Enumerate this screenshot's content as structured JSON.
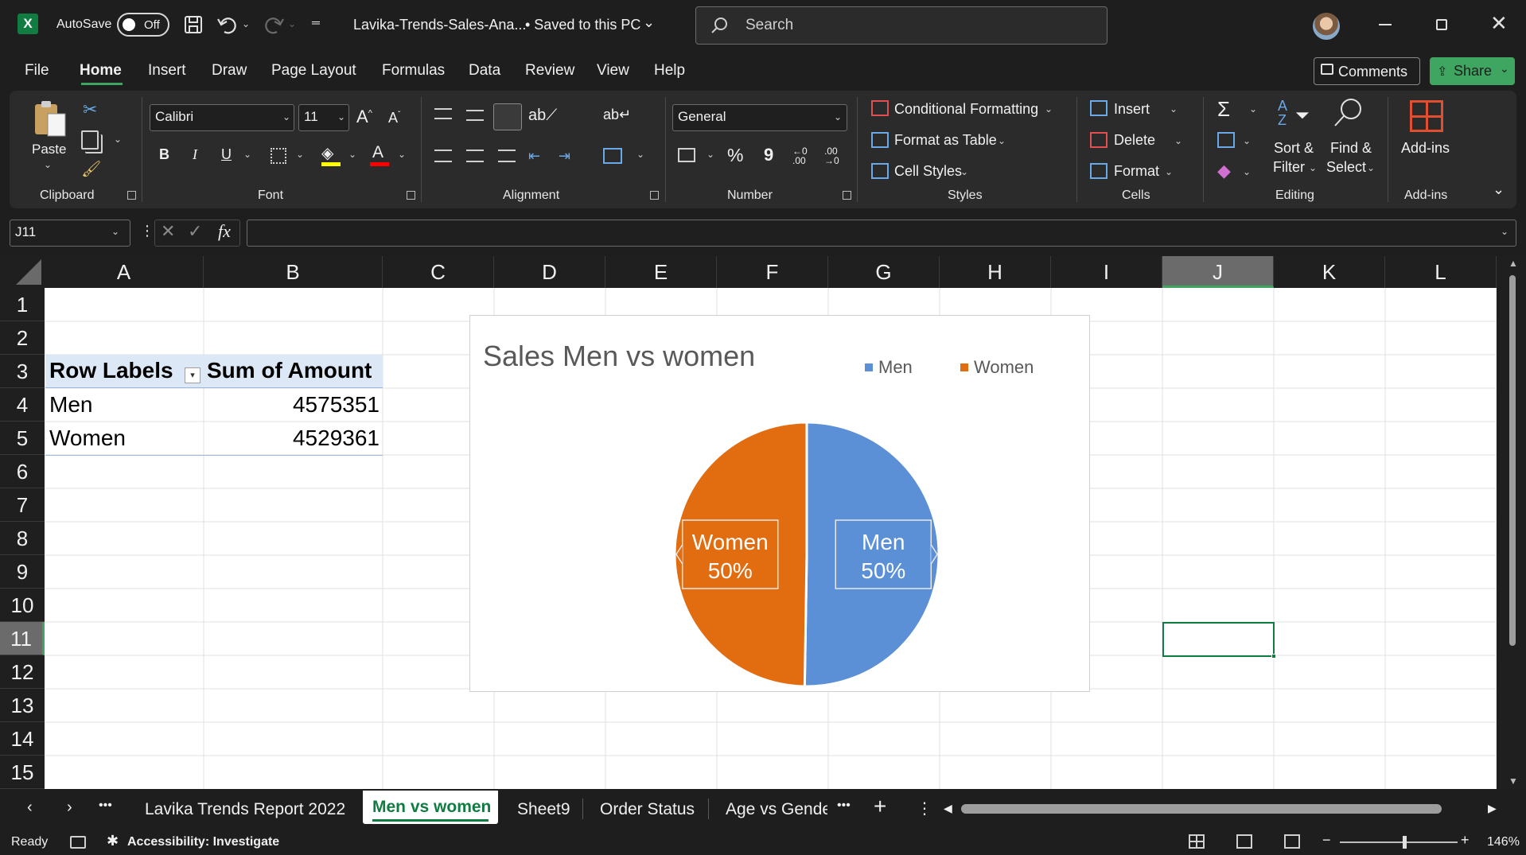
{
  "titlebar": {
    "app_icon": "excel-logo-icon",
    "autosave_label": "AutoSave",
    "autosave_state": "Off",
    "filename": "Lavika-Trends-Sales-Ana...",
    "save_status": "• Saved to this PC",
    "search_placeholder": "Search"
  },
  "menu": {
    "tabs": [
      "File",
      "Home",
      "Insert",
      "Draw",
      "Page Layout",
      "Formulas",
      "Data",
      "Review",
      "View",
      "Help"
    ],
    "active": "Home",
    "comments": "Comments",
    "share": "Share"
  },
  "ribbon": {
    "clipboard": {
      "paste": "Paste",
      "group": "Clipboard"
    },
    "font": {
      "name": "Calibri",
      "size": "11",
      "bold": "B",
      "italic": "I",
      "underline": "U",
      "color_a": "A",
      "group": "Font"
    },
    "alignment": {
      "group": "Alignment"
    },
    "number": {
      "format": "General",
      "percent": "%",
      "comma": "9",
      "group": "Number"
    },
    "styles": {
      "conditional": "Conditional Formatting",
      "format_table": "Format as Table",
      "cell_styles": "Cell Styles",
      "group": "Styles"
    },
    "cells": {
      "insert": "Insert",
      "delete": "Delete",
      "format": "Format",
      "group": "Cells"
    },
    "editing": {
      "sort1": "Sort &",
      "sort2": "Filter",
      "find1": "Find &",
      "find2": "Select",
      "group": "Editing"
    },
    "addins": {
      "label": "Add-ins",
      "group": "Add-ins"
    }
  },
  "formula_bar": {
    "name_box": "J11",
    "formula": ""
  },
  "grid": {
    "columns": [
      "A",
      "B",
      "C",
      "D",
      "E",
      "F",
      "G",
      "H",
      "I",
      "J",
      "K",
      "L"
    ],
    "rows": [
      "1",
      "2",
      "3",
      "4",
      "5",
      "6",
      "7",
      "8",
      "9",
      "10",
      "11",
      "12",
      "13",
      "14",
      "15"
    ],
    "selected_cell": "J11",
    "pivot": {
      "header_row_labels": "Row Labels",
      "header_sum": "Sum of Amount",
      "rows": [
        {
          "label": "Men",
          "value": "4575351"
        },
        {
          "label": "Women",
          "value": "4529361"
        }
      ]
    }
  },
  "chart_data": {
    "type": "pie",
    "title": "Sales Men vs women",
    "categories": [
      "Men",
      "Women"
    ],
    "values": [
      4575351,
      4529361
    ],
    "labels": [
      {
        "name": "Men",
        "pct": "50%"
      },
      {
        "name": "Women",
        "pct": "50%"
      }
    ],
    "colors": [
      "#5b8fd6",
      "#e26c10"
    ],
    "legend_position": "top-right"
  },
  "sheet_tabs": {
    "tabs": [
      "Lavika Trends Report 2022",
      "Men vs women",
      "Sheet9",
      "Order Status",
      "Age vs Gende"
    ],
    "active": "Men vs women"
  },
  "status": {
    "ready": "Ready",
    "accessibility": "Accessibility: Investigate",
    "zoom": "146%"
  },
  "colors": {
    "accent_green": "#107c41",
    "share_green": "#3fa661"
  }
}
